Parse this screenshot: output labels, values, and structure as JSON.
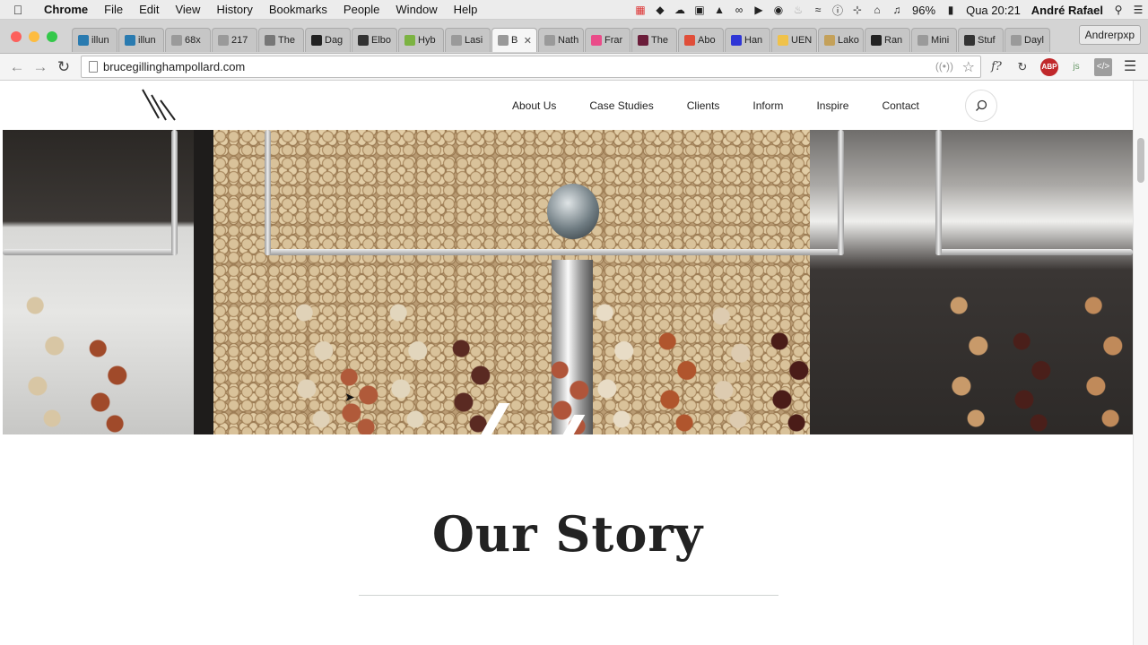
{
  "menubar": {
    "app": "Chrome",
    "items": [
      "File",
      "Edit",
      "View",
      "History",
      "Bookmarks",
      "People",
      "Window",
      "Help"
    ],
    "battery": "96%",
    "clock": "Qua 20:21",
    "user": "André Rafael"
  },
  "tabs": [
    {
      "label": "illun",
      "icon": "wordpress-icon",
      "color": "#2a7bb0"
    },
    {
      "label": "illun",
      "icon": "wordpress-icon",
      "color": "#2a7bb0"
    },
    {
      "label": "68x",
      "icon": "page-icon",
      "color": "#9a9a9a"
    },
    {
      "label": "217",
      "icon": "page-icon",
      "color": "#9a9a9a"
    },
    {
      "label": "The",
      "icon": "s-icon",
      "color": "#777777"
    },
    {
      "label": "Dag",
      "icon": "star-icon",
      "color": "#222222"
    },
    {
      "label": "Elbo",
      "icon": "e-icon",
      "color": "#333333"
    },
    {
      "label": "Hyb",
      "icon": "h-icon",
      "color": "#7cb342"
    },
    {
      "label": "Lasi",
      "icon": "page-icon",
      "color": "#9a9a9a"
    },
    {
      "label": "B",
      "icon": "site-icon",
      "color": "#999999",
      "active": true
    },
    {
      "label": "Nath",
      "icon": "page-icon",
      "color": "#9a9a9a"
    },
    {
      "label": "Frar",
      "icon": "dribbble-icon",
      "color": "#ea4c89"
    },
    {
      "label": "The",
      "icon": "square-icon",
      "color": "#6b1d3a"
    },
    {
      "label": "Abo",
      "icon": "g-icon",
      "color": "#e04e39"
    },
    {
      "label": "Han",
      "icon": "circle-icon",
      "color": "#2f36d6"
    },
    {
      "label": "UEN",
      "icon": "circle-icon",
      "color": "#f0c24a"
    },
    {
      "label": "Lako",
      "icon": "tag-icon",
      "color": "#c4a15a"
    },
    {
      "label": "Ran",
      "icon": "r-icon",
      "color": "#222222"
    },
    {
      "label": "Mini",
      "icon": "page-icon",
      "color": "#9a9a9a"
    },
    {
      "label": "Stuf",
      "icon": "heart-icon",
      "color": "#333333"
    },
    {
      "label": "Dayl",
      "icon": "page-icon",
      "color": "#9a9a9a"
    }
  ],
  "profile_name": "Andrerpxp",
  "address": {
    "url": "brucegillinghampollard.com"
  },
  "site": {
    "nav": [
      "About Us",
      "Case Studies",
      "Clients",
      "Inform",
      "Inspire",
      "Contact"
    ],
    "story_title": "Our Story"
  },
  "colors": {
    "nav_text": "#222222",
    "rule": "#cfd4d2",
    "close_red": "#fc605c",
    "minimize_yellow": "#fdbc40",
    "zoom_green": "#34c84a"
  }
}
